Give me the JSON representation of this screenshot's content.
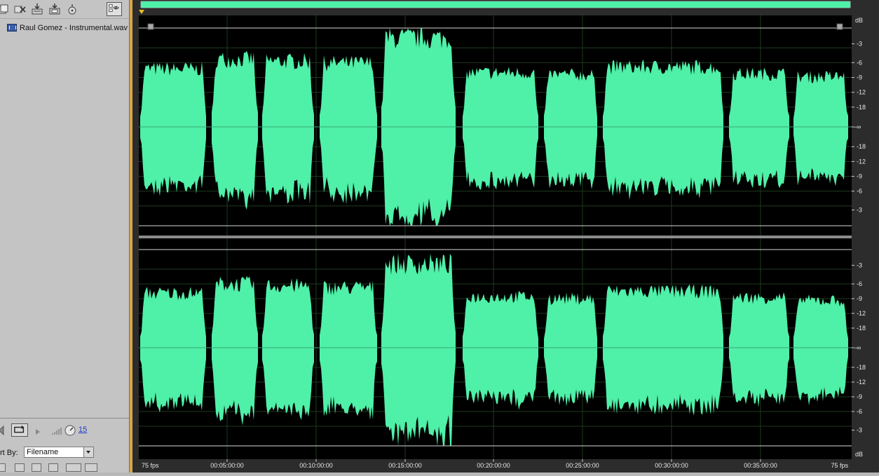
{
  "file_panel": {
    "files": [
      {
        "name": "Raul Gomez - Instrumental.wav"
      }
    ],
    "zoom_value": "15",
    "sort_label": "rt By:",
    "sort_value": "Filename"
  },
  "editor": {
    "db_scale": {
      "unit": "dB",
      "channel1": [
        "-3",
        "-6",
        "-9",
        "-12",
        "-18",
        "-∞",
        "-18",
        "-12",
        "-9",
        "-6",
        "-3"
      ],
      "channel2": [
        "-3",
        "-6",
        "-9",
        "-12",
        "-18",
        "-∞",
        "-18",
        "-12",
        "-9",
        "-6",
        "-3"
      ],
      "bottom_unit": "dB"
    },
    "timeline": {
      "start_label": "75 fps",
      "ticks": [
        "00:05:00:00",
        "00:10:00:00",
        "00:15:00:00",
        "00:20:00:00",
        "00:25:00:00",
        "00:30:00:00",
        "00:35:00:00"
      ],
      "end_label": "75 fps"
    },
    "colors": {
      "waveform": "#4ff0a8",
      "background": "#000000",
      "grid": "#1e3a1e",
      "splitter": "#d8a64a"
    }
  }
}
